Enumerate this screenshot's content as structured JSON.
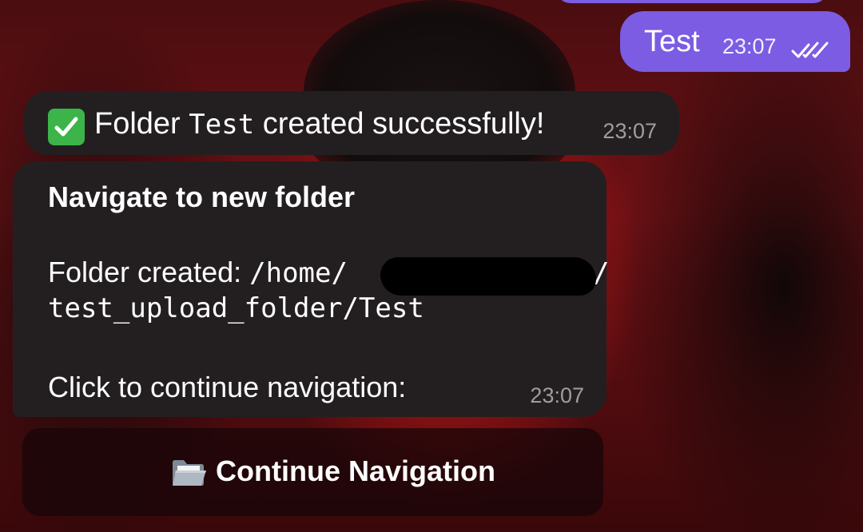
{
  "outgoing": {
    "text": "Test",
    "time": "23:07",
    "status_icon": "double-check-icon"
  },
  "bot_message_1": {
    "icon": "check-mark-button-icon",
    "text_before": "Folder ",
    "folder_name": "Test",
    "text_after": " created successfully!",
    "time": "23:07"
  },
  "bot_message_2": {
    "title": "Navigate to new folder",
    "path_label": "Folder created: ",
    "path_start": "/home/",
    "path_redacted_end": "/",
    "path_continued": "test_upload_folder/Test",
    "cta_text": "Click to continue navigation:",
    "time": "23:07"
  },
  "inline_keyboard": {
    "button_icon": "folder-icon",
    "button_label": "Continue Navigation"
  },
  "colors": {
    "outgoing_bubble": "#7b5ce3",
    "incoming_bubble": "#231f20",
    "timestamp_incoming": "#a39c9c",
    "check_green": "#3cb44a"
  }
}
